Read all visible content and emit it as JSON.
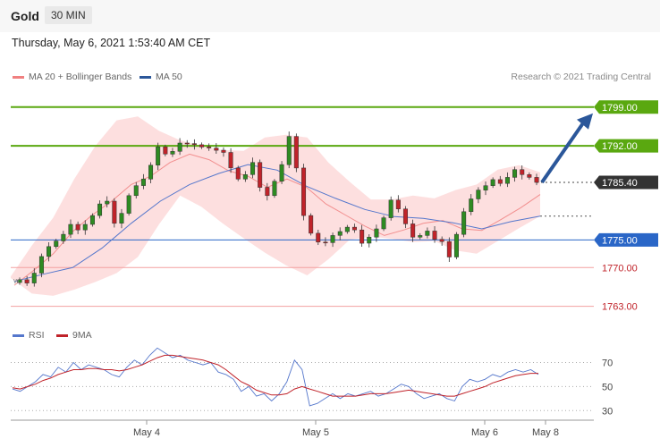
{
  "header": {
    "ticker": "Gold",
    "timeframe": "30 MIN"
  },
  "datetime": "Thursday, May 6, 2021 1:53:40 AM CET",
  "legend": {
    "ma20": "MA 20 + Bollinger Bands",
    "ma50": "MA 50",
    "rsi": "RSI",
    "ma9": "9MA"
  },
  "copyright": "Research © 2021 Trading Central",
  "colors": {
    "resistance": "#5aa810",
    "support": "#2a66c7",
    "ma20": "#f08080",
    "ma50": "#5577cc",
    "bollinger": "#fcd7d7",
    "up_candle": "#2e8b22",
    "down_candle": "#c0232a",
    "arrow": "#2b579a",
    "current": "#333333"
  },
  "chart_data": [
    {
      "type": "candlestick",
      "instrument": "Gold",
      "interval": "30 MIN",
      "x_ticks": [
        "May 4",
        "May 5",
        "May 6",
        "May 8"
      ],
      "ylim": [
        1761,
        1803
      ],
      "levels": [
        {
          "value": 1799.0,
          "label": "1799.00",
          "kind": "resistance"
        },
        {
          "value": 1792.0,
          "label": "1792.00",
          "kind": "resistance"
        },
        {
          "value": 1785.4,
          "label": "1785.40",
          "kind": "current"
        },
        {
          "value": 1775.0,
          "label": "1775.00",
          "kind": "support"
        },
        {
          "value": 1770.0,
          "label": "1770.00",
          "kind": "support-minor"
        },
        {
          "value": 1763.0,
          "label": "1763.00",
          "kind": "support-minor"
        }
      ],
      "forecast_target": 1799.0,
      "close_path": [
        1767.8,
        1767.2,
        1769.0,
        1772.0,
        1773.8,
        1774.8,
        1776.0,
        1777.8,
        1776.8,
        1777.8,
        1779.4,
        1781.5,
        1782.0,
        1778.0,
        1779.8,
        1783.0,
        1784.8,
        1786.0,
        1788.5,
        1791.8,
        1790.5,
        1791.0,
        1792.5,
        1792.4,
        1792.2,
        1791.8,
        1791.6,
        1791.2,
        1790.8,
        1788.0,
        1786.0,
        1786.8,
        1789.0,
        1784.5,
        1783.0,
        1785.6,
        1788.6,
        1793.7,
        1788.0,
        1779.4,
        1776.2,
        1774.6,
        1774.5,
        1775.8,
        1776.5,
        1777.3,
        1776.8,
        1774.4,
        1775.5,
        1777.0,
        1779.0,
        1782.2,
        1780.6,
        1777.9,
        1775.5,
        1775.8,
        1776.6,
        1775.1,
        1774.7,
        1771.9,
        1776.0,
        1780.1,
        1782.4,
        1784.0,
        1784.8,
        1785.9,
        1785.2,
        1786.3,
        1787.7,
        1786.8,
        1786.3,
        1785.4
      ],
      "ma20_path": [
        1766.8,
        1769.5,
        1772.5,
        1776.5,
        1779.5,
        1782.0,
        1785.0,
        1786.5,
        1789.0,
        1790.5,
        1789.5,
        1787.5,
        1786.5,
        1784.5,
        1786.0,
        1784.5,
        1781.5,
        1779.5,
        1777.5,
        1775.8,
        1776.8,
        1778.0,
        1778.5,
        1777.0,
        1776.7,
        1778.7,
        1780.8,
        1783.2
      ],
      "ma50_path": [
        1767.5,
        1768.8,
        1770.0,
        1773.5,
        1778.0,
        1782.0,
        1785.0,
        1787.0,
        1788.6,
        1787.6,
        1784.7,
        1782.5,
        1780.5,
        1779.2,
        1778.9,
        1778.1,
        1777.0,
        1778.3,
        1779.3
      ],
      "bollinger_upper": [
        1768.4,
        1774.0,
        1779.0,
        1786.0,
        1792.0,
        1796.6,
        1797.3,
        1794.7,
        1793.0,
        1792.0,
        1791.2,
        1791.1,
        1793.5,
        1794.0,
        1793.5,
        1789.0,
        1785.5,
        1782.3,
        1782.3,
        1783.0,
        1782.5,
        1784.0,
        1785.0,
        1787.7,
        1788.5,
        1787.2
      ],
      "bollinger_lower": [
        1768.1,
        1765.3,
        1764.9,
        1766.0,
        1767.4,
        1769.0,
        1771.9,
        1777.8,
        1783.0,
        1781.0,
        1778.0,
        1775.3,
        1772.7,
        1770.4,
        1768.6,
        1771.5,
        1775.0,
        1775.6,
        1775.2,
        1774.6,
        1774.8,
        1773.1,
        1772.5,
        1774.8,
        1777.1,
        1779.3
      ],
      "marker_label": "W"
    },
    {
      "type": "line",
      "name": "RSI",
      "ylim": [
        25,
        80
      ],
      "y_ticks": [
        70,
        50,
        30
      ],
      "series": [
        {
          "name": "RSI",
          "values": [
            48,
            46,
            50,
            54,
            60,
            58,
            66,
            62,
            70,
            64,
            68,
            66,
            64,
            60,
            58,
            66,
            72,
            68,
            76,
            82,
            78,
            74,
            76,
            72,
            70,
            68,
            70,
            62,
            60,
            56,
            46,
            50,
            42,
            44,
            38,
            44,
            54,
            72,
            64,
            34,
            36,
            40,
            44,
            40,
            44,
            42,
            44,
            46,
            42,
            44,
            48,
            52,
            50,
            44,
            40,
            42,
            44,
            40,
            38,
            50,
            56,
            54,
            56,
            60,
            58,
            62,
            64,
            62,
            64,
            60
          ]
        },
        {
          "name": "9MA",
          "values": [
            49,
            48,
            50,
            52,
            55,
            57,
            60,
            62,
            64,
            64,
            65,
            65,
            64,
            64,
            63,
            64,
            66,
            68,
            71,
            74,
            76,
            76,
            75,
            74,
            73,
            72,
            70,
            68,
            64,
            59,
            54,
            51,
            47,
            45,
            43,
            43,
            44,
            48,
            50,
            48,
            46,
            44,
            42,
            42,
            42,
            42,
            43,
            44,
            44,
            44,
            45,
            46,
            47,
            46,
            45,
            44,
            43,
            42,
            42,
            44,
            46,
            48,
            50,
            53,
            55,
            57,
            59,
            60,
            61,
            61
          ]
        }
      ]
    }
  ]
}
